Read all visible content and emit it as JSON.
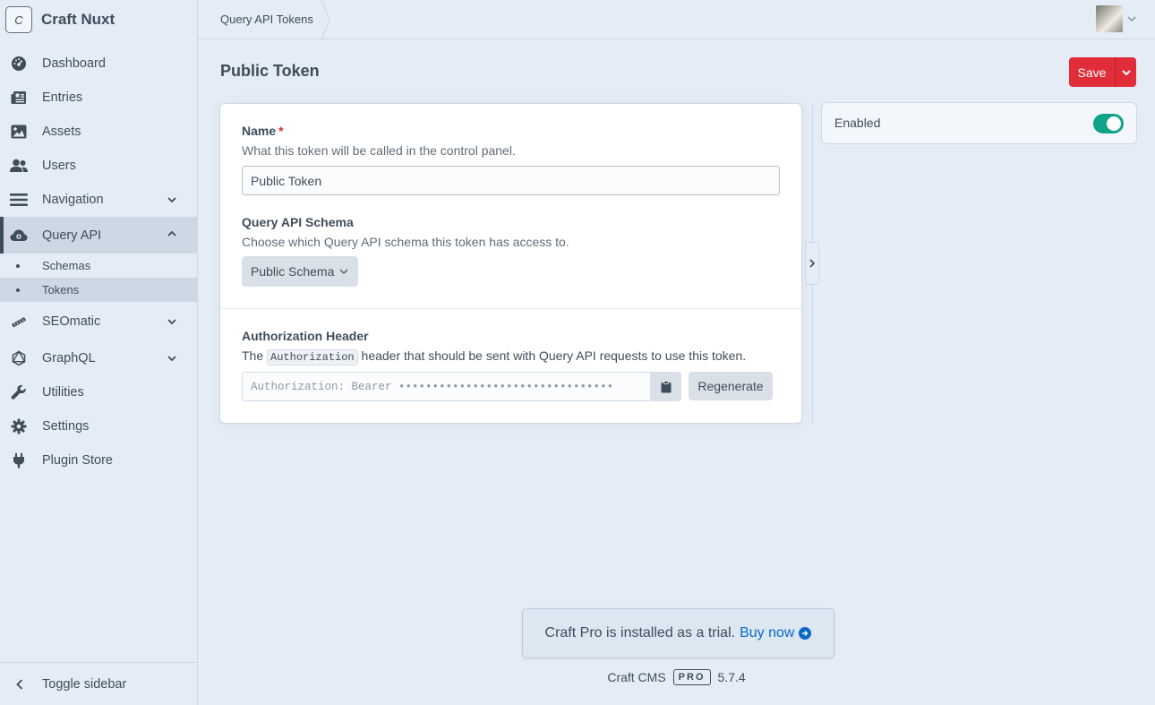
{
  "site": {
    "logo_letter": "C",
    "name": "Craft Nuxt"
  },
  "nav": {
    "items": [
      {
        "label": "Dashboard",
        "icon": "gauge-icon"
      },
      {
        "label": "Entries",
        "icon": "newspaper-icon"
      },
      {
        "label": "Assets",
        "icon": "image-icon"
      },
      {
        "label": "Users",
        "icon": "users-icon"
      },
      {
        "label": "Navigation",
        "icon": "bars-icon",
        "expandable": true
      },
      {
        "label": "Query API",
        "icon": "cloud-gear-icon",
        "expanded": true,
        "active": true
      },
      {
        "label": "SEOmatic",
        "icon": "seomatic-icon",
        "expandable": true
      },
      {
        "label": "GraphQL",
        "icon": "graphql-icon",
        "expandable": true
      },
      {
        "label": "Utilities",
        "icon": "wrench-icon"
      },
      {
        "label": "Settings",
        "icon": "gear-icon"
      },
      {
        "label": "Plugin Store",
        "icon": "plug-icon"
      }
    ],
    "query_api_subitems": [
      {
        "label": "Schemas"
      },
      {
        "label": "Tokens",
        "current": true
      }
    ],
    "toggle_sidebar_label": "Toggle sidebar"
  },
  "header": {
    "breadcrumb": "Query API Tokens"
  },
  "page": {
    "title": "Public Token",
    "save_label": "Save"
  },
  "form": {
    "name": {
      "label": "Name",
      "required_mark": "*",
      "instructions": "What this token will be called in the control panel.",
      "value": "Public Token"
    },
    "schema": {
      "label": "Query API Schema",
      "instructions": "Choose which Query API schema this token has access to.",
      "selected": "Public Schema"
    },
    "auth_header": {
      "label": "Authorization Header",
      "instructions_before": "The",
      "instructions_code": "Authorization",
      "instructions_after": "header that should be sent with Query API requests to use this token.",
      "value": "Authorization: Bearer ••••••••••••••••••••••••••••••••",
      "regenerate_label": "Regenerate"
    }
  },
  "meta": {
    "enabled_label": "Enabled",
    "enabled": true
  },
  "footer": {
    "trial_text": "Craft Pro is installed as a trial.",
    "buy_now_label": "Buy now",
    "cms_name": "Craft CMS",
    "edition": "PRO",
    "version": "5.7.4"
  },
  "colors": {
    "accent_red": "#e12d39",
    "toggle_green": "#10a38a",
    "link_blue": "#0b69c7"
  }
}
